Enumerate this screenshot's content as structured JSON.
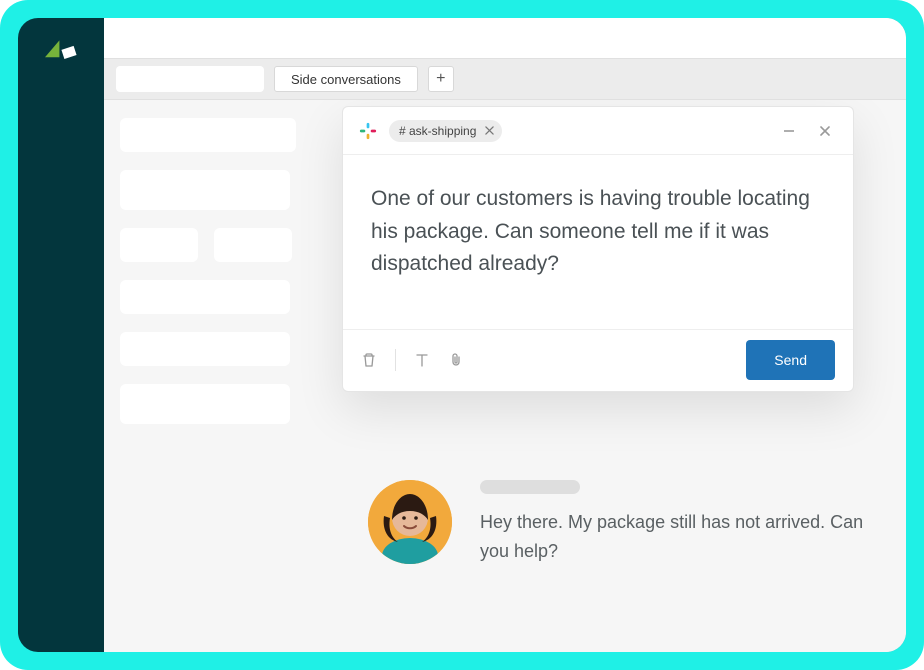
{
  "tabs": {
    "side_conversations": "Side conversations",
    "add_symbol": "+"
  },
  "compose": {
    "channel_chip": "#  ask-shipping",
    "body": "One of our customers is having trouble locating his package. Can someone tell me if it was dispatched already?",
    "send_label": "Send"
  },
  "conversation": {
    "message": "Hey there. My package still has not arrived. Can you help?"
  }
}
